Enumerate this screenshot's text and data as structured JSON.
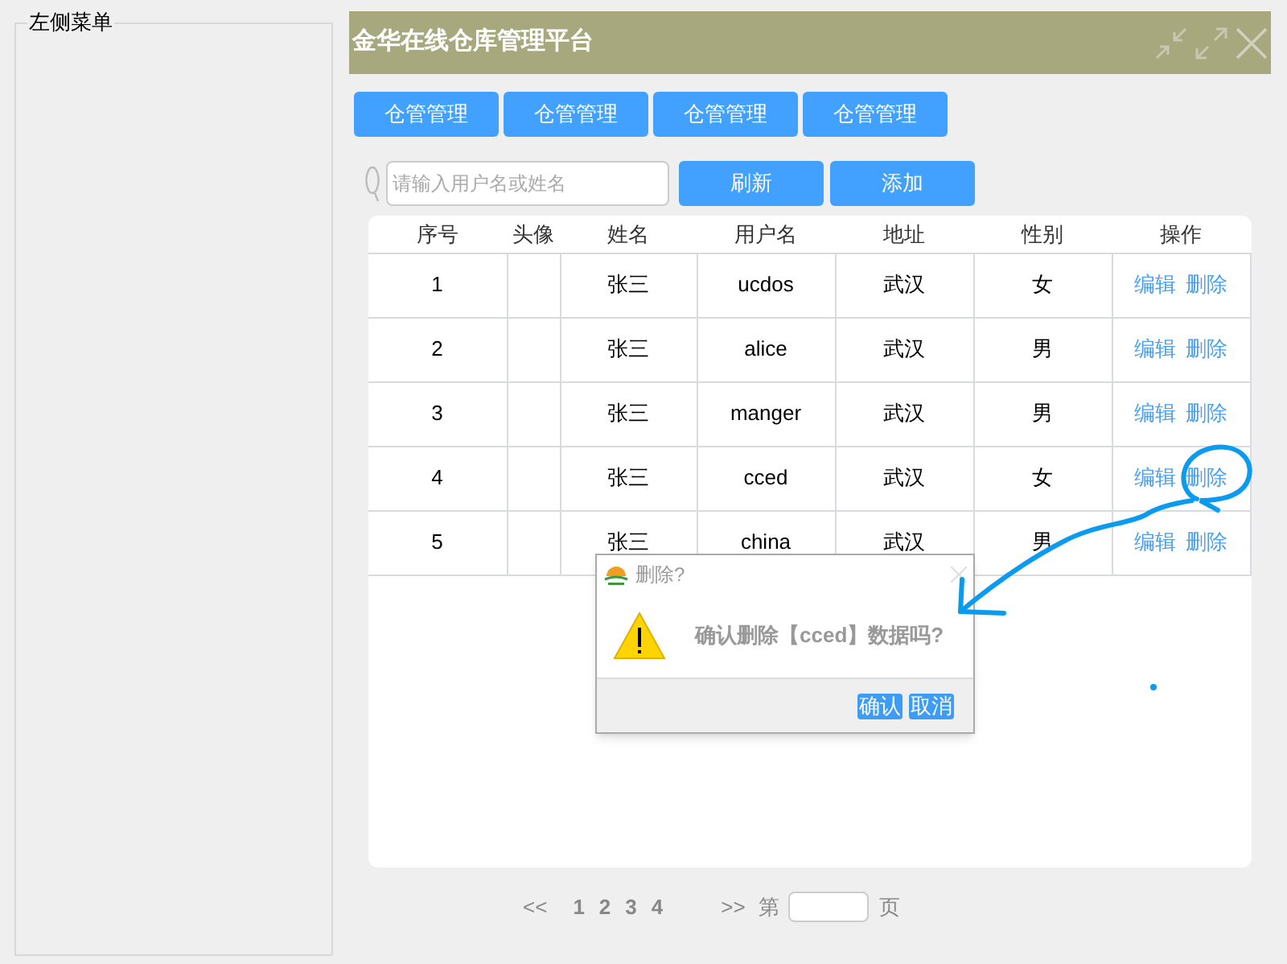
{
  "sidebar": {
    "legend": "左侧菜单"
  },
  "window": {
    "title": "金华在线仓库管理平台"
  },
  "tabs": [
    {
      "label": "仓管管理"
    },
    {
      "label": "仓管管理"
    },
    {
      "label": "仓管管理"
    },
    {
      "label": "仓管管理"
    }
  ],
  "search": {
    "placeholder": "请输入用户名或姓名"
  },
  "buttons": [
    "刷新",
    "添加"
  ],
  "table": {
    "columns": [
      "序号",
      "头像",
      "姓名",
      "用户名",
      "地址",
      "性别",
      "操作"
    ],
    "rows": [
      {
        "cells": [
          "1",
          "",
          "张三",
          "ucdos",
          "武汉",
          "女"
        ],
        "actions": [
          "编辑",
          "删除"
        ]
      },
      {
        "cells": [
          "2",
          "",
          "张三",
          "alice",
          "武汉",
          "男"
        ],
        "actions": [
          "编辑",
          "删除"
        ]
      },
      {
        "cells": [
          "3",
          "",
          "张三",
          "manger",
          "武汉",
          "男"
        ],
        "actions": [
          "编辑",
          "删除"
        ]
      },
      {
        "cells": [
          "4",
          "",
          "张三",
          "cced",
          "武汉",
          "女"
        ],
        "actions": [
          "编辑",
          "删除"
        ]
      },
      {
        "cells": [
          "5",
          "",
          "张三",
          "china",
          "武汉",
          "男"
        ],
        "actions": [
          "编辑",
          "删除"
        ]
      }
    ]
  },
  "dialog": {
    "title": "删除?",
    "message": "确认删除【cced】数据吗?",
    "buttons": [
      "确认",
      "取消"
    ]
  },
  "pagination": {
    "prev": "<<",
    "pages": [
      "1",
      "2",
      "3",
      "4"
    ],
    "next": ">>",
    "before": "第",
    "after": "页"
  }
}
